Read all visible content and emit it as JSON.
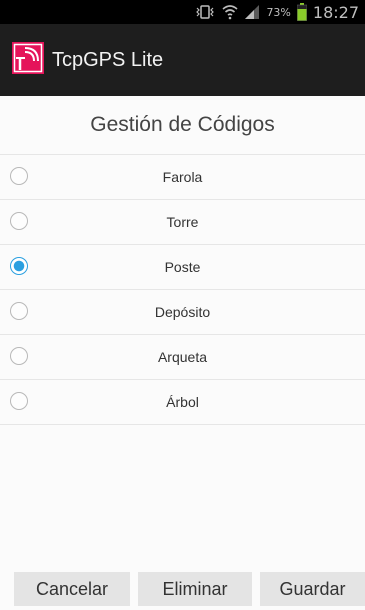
{
  "status_bar": {
    "battery_percent": "73%",
    "time": "18:27"
  },
  "app": {
    "title": "TcpGPS Lite",
    "accent": "#e5145a"
  },
  "page": {
    "heading": "Gestión de Códigos"
  },
  "codes": [
    {
      "label": "Farola",
      "checked": false
    },
    {
      "label": "Torre",
      "checked": false
    },
    {
      "label": "Poste",
      "checked": true
    },
    {
      "label": "Depósito",
      "checked": false
    },
    {
      "label": "Arqueta",
      "checked": false
    },
    {
      "label": "Árbol",
      "checked": false
    }
  ],
  "buttons": {
    "cancel": "Cancelar",
    "delete": "Eliminar",
    "save": "Guardar"
  }
}
